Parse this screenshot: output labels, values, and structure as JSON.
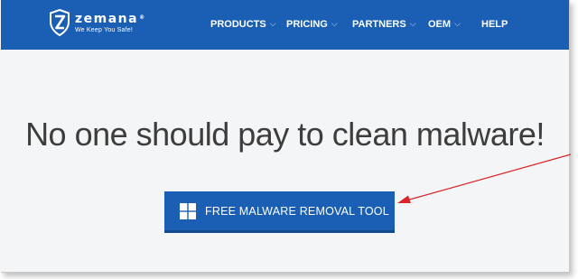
{
  "brand": {
    "name": "zemana",
    "registered": "®",
    "tagline": "We Keep You Safe!"
  },
  "nav": {
    "items": [
      {
        "label": "PRODUCTS",
        "dropdown": true
      },
      {
        "label": "PRICING",
        "dropdown": true
      },
      {
        "label": "PARTNERS",
        "dropdown": true
      },
      {
        "label": "OEM",
        "dropdown": true
      },
      {
        "label": "HELP",
        "dropdown": false
      }
    ]
  },
  "hero": {
    "headline": "No one should pay to clean malware!",
    "cta_label": "FREE MALWARE REMOVAL TOOL",
    "cta_icon": "windows-icon"
  },
  "annotation": {
    "type": "arrow",
    "color": "#d9252a"
  },
  "colors": {
    "brand_blue": "#1b5fb5",
    "text_dark": "#3d3d3d",
    "background": "#f4f5f6"
  }
}
